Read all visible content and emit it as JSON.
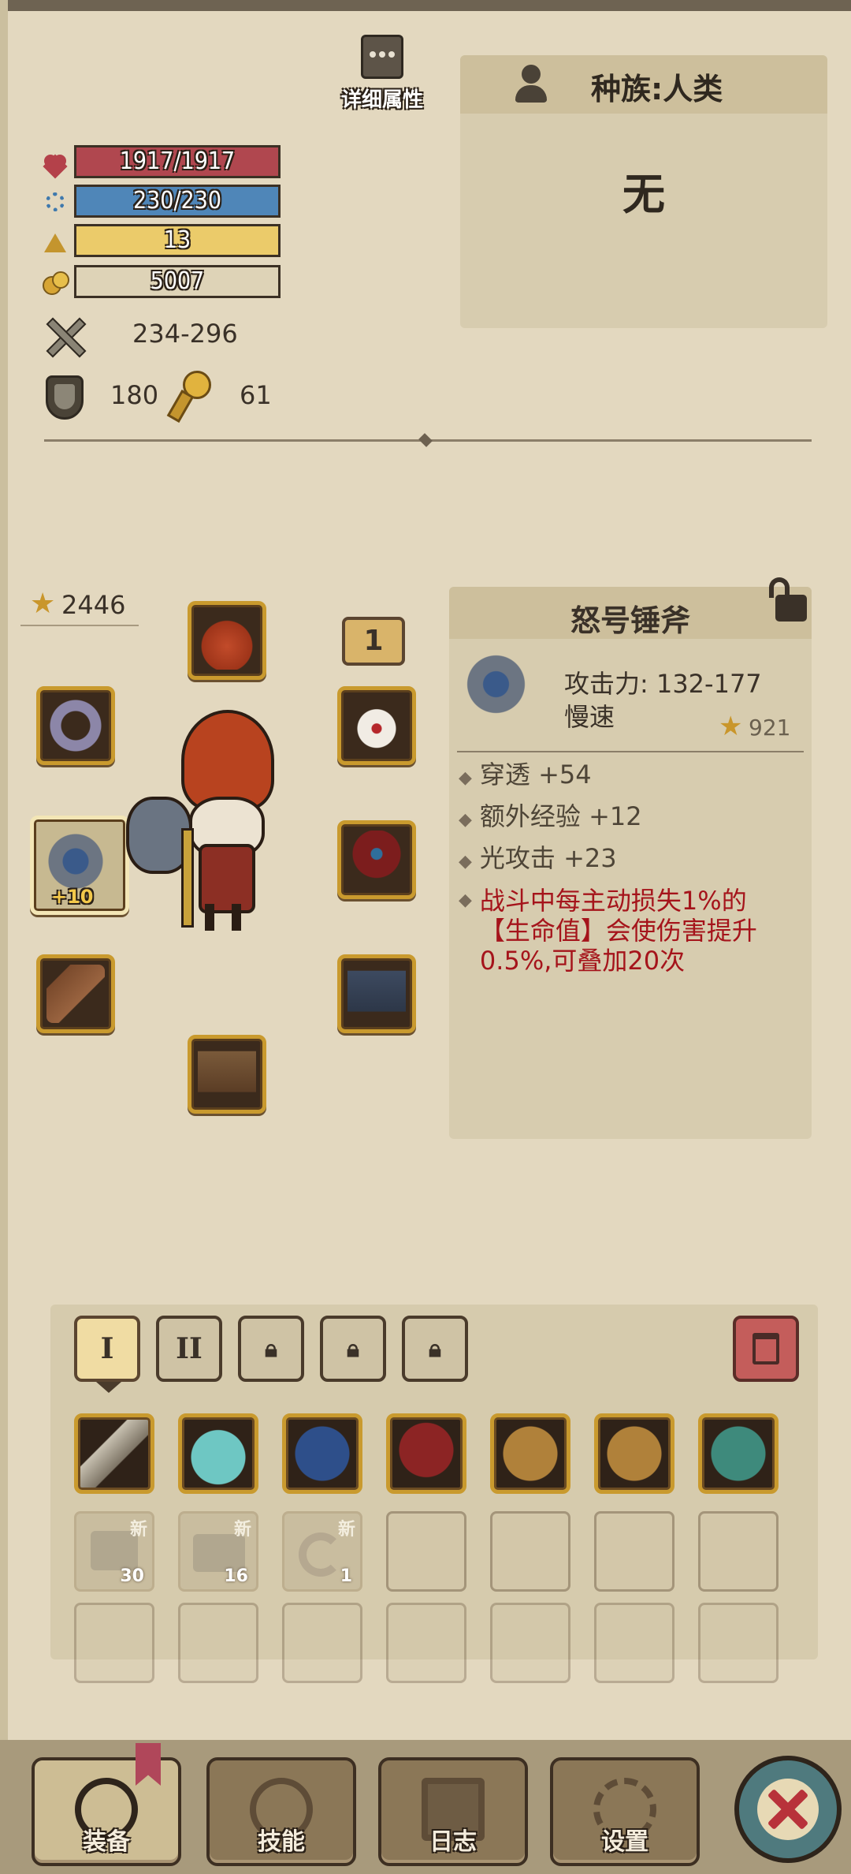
{
  "header": {
    "detail_label": "详细属性"
  },
  "race": {
    "label": "种族:人类",
    "title": "无"
  },
  "stats": {
    "hp": "1917/1917",
    "mp": "230/230",
    "level": "13",
    "gold": "5007",
    "attack": "234-296",
    "armor": "180",
    "luck": "61"
  },
  "equipment": {
    "star_total": "2446",
    "level_badge": "1",
    "weapon_plus": "+10"
  },
  "item_detail": {
    "name": "怒号锤斧",
    "attack": "攻击力: 132-177",
    "speed": "慢速",
    "star": "921",
    "affixes": [
      "穿透 +54",
      "额外经验 +12",
      "光攻击 +23"
    ],
    "special": "战斗中每主动损失1%的【生命值】会使伤害提升0.5%,可叠加20次"
  },
  "inventory": {
    "tabs": [
      "I",
      "II"
    ],
    "new_label": "新",
    "ghost_counts": [
      "30",
      "16",
      "1"
    ]
  },
  "nav": {
    "equip": "装备",
    "skills": "技能",
    "log": "日志",
    "settings": "设置"
  },
  "colors": {
    "hp": "#b0474f",
    "mp": "#4f86b8",
    "level": "#ebcb6a",
    "special": "#a5141b",
    "frame": "#c99a2e"
  }
}
